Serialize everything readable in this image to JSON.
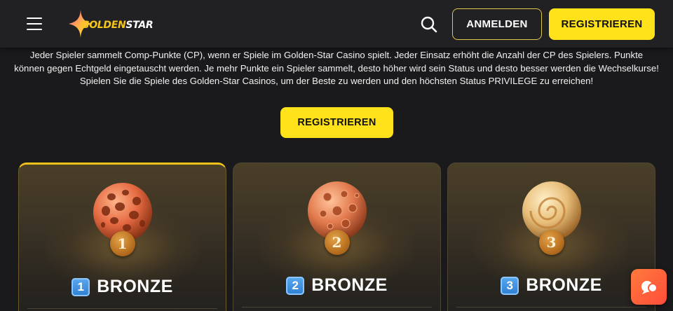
{
  "header": {
    "logo_text_1": "GOLDEN",
    "logo_text_2": "STAR",
    "login_label": "ANMELDEN",
    "register_label": "REGISTRIEREN",
    "icons": {
      "menu": "hamburger-menu-icon",
      "search": "search-icon",
      "star": "star-logo-icon"
    }
  },
  "intro": {
    "text": "Jeder Spieler sammelt Comp-Punkte (CP), wenn er Spiele im Golden-Star Casino spielt. Jeder Einsatz erhöht die Anzahl der CP des Spielers. Punkte können gegen Echtgeld eingetauscht werden. Je mehr Punkte ein Spieler sammelt, desto höher wird sein Status und desto besser werden die Wechselkurse! Spielen Sie die Spiele des Golden-Star Casinos, um der Beste zu werden und den höchsten Status PRIVILEGE zu erreichen!",
    "cta_label": "REGISTRIEREN"
  },
  "levels": [
    {
      "number": "1",
      "keycap": "1",
      "name": "BRONZE"
    },
    {
      "number": "2",
      "keycap": "2",
      "name": "BRONZE"
    },
    {
      "number": "3",
      "keycap": "3",
      "name": "BRONZE"
    }
  ],
  "colors": {
    "accent": "#ffe21a",
    "background": "#1a1a1c",
    "header": "#212124",
    "chat": "#ff5a3a"
  }
}
